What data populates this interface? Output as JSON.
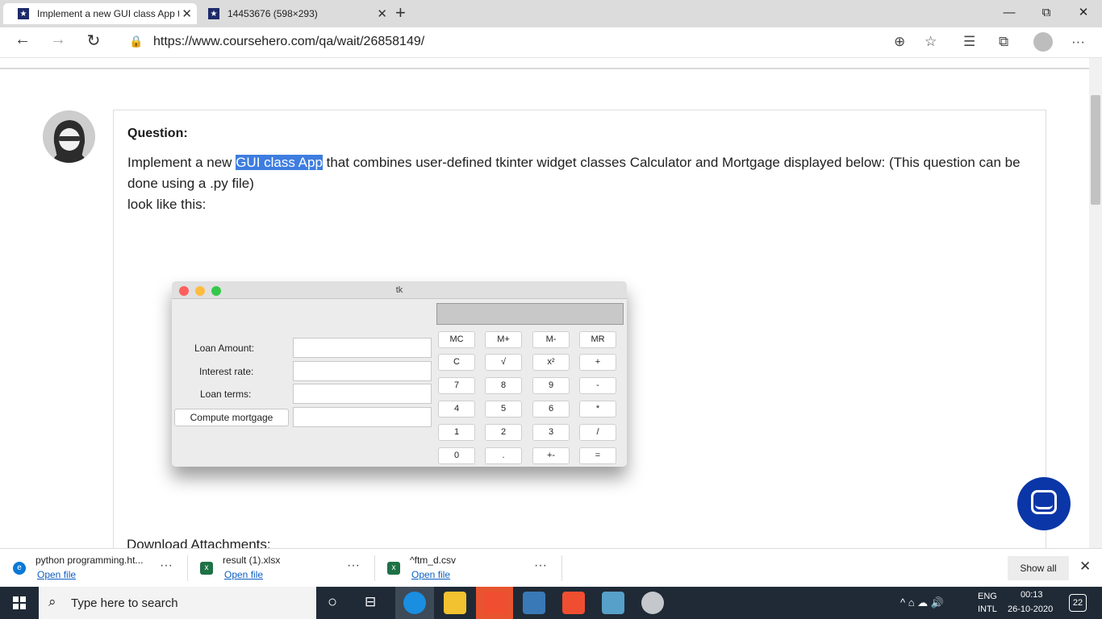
{
  "browser": {
    "tabs": [
      {
        "title": "Implement a new GUI class App t",
        "active": true
      },
      {
        "title": "14453676 (598×293)",
        "active": false
      }
    ],
    "address_url": "https://www.coursehero.com/qa/wait/26858149/",
    "new_tab_glyph": "+",
    "close_glyph": "✕",
    "minimize_glyph": "—",
    "restore_glyph": "⧉",
    "window_close_glyph": "✕",
    "back_glyph": "←",
    "forward_glyph": "→",
    "refresh_glyph": "↻",
    "lock_glyph": "🔒",
    "zoom_glyph": "⊕",
    "star_glyph": "☆",
    "favorites_glyph": "☰",
    "collections_glyph": "⧉",
    "more_glyph": "···"
  },
  "page": {
    "question_label": "Question:",
    "question_pre": "Implement a new ",
    "question_highlight": "GUI class App",
    "question_post": " that combines user-defined tkinter widget classes Calculator and Mortgage displayed below: (This question can be done using a .py file)",
    "question_line2": "look like this:",
    "attachments_label": "Download Attachments:"
  },
  "tk_window": {
    "title": "tk",
    "labels": [
      "Loan Amount:",
      "Interest rate:",
      "Loan terms:"
    ],
    "compute_button": "Compute mortgage",
    "keys": [
      [
        "MC",
        "M+",
        "M-",
        "MR"
      ],
      [
        "C",
        "√",
        "x²",
        "+"
      ],
      [
        "7",
        "8",
        "9",
        "-"
      ],
      [
        "4",
        "5",
        "6",
        "*"
      ],
      [
        "1",
        "2",
        "3",
        "/"
      ],
      [
        "0",
        ".",
        "+-",
        "="
      ]
    ]
  },
  "downloads": [
    {
      "name": "python programming.ht...",
      "action": "Open file",
      "icon": "edge-icon",
      "color": "#0a78d7"
    },
    {
      "name": "result (1).xlsx",
      "action": "Open file",
      "icon": "excel-icon",
      "color": "#1e7145"
    },
    {
      "name": "^ftm_d.csv",
      "action": "Open file",
      "icon": "excel-icon",
      "color": "#1e7145"
    }
  ],
  "downloads_more": "···",
  "show_all": "Show all",
  "dl_close": "✕",
  "taskbar": {
    "search_placeholder": "Type here to search",
    "search_glyph": "⌕",
    "cortana_glyph": "○",
    "taskview_glyph": "⊟",
    "tray_lang1": "ENG",
    "tray_lang2": "INTL",
    "time": "00:13",
    "date": "26-10-2020",
    "notifications": "22",
    "tray_icons": "^  ⌂  ☁  🔊"
  },
  "colors": {
    "accent": "#0a36a8",
    "highlight": "#3e7de0",
    "taskbar": "#1f2a36"
  }
}
